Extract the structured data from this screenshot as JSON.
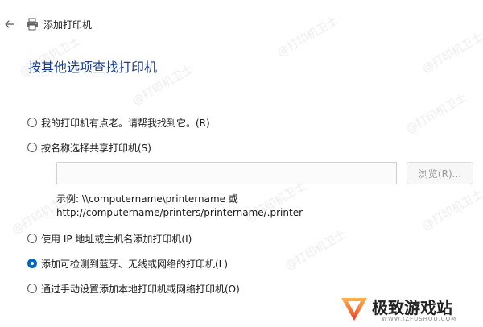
{
  "window": {
    "title": "添加打印机"
  },
  "heading": "按其他选项查找打印机",
  "options": [
    {
      "label": "我的打印机有点老。请帮我找到它。(R)",
      "checked": false
    },
    {
      "label": "按名称选择共享打印机(S)",
      "checked": false
    },
    {
      "label": "使用 IP 地址或主机名添加打印机(I)",
      "checked": false
    },
    {
      "label": "添加可检测到蓝牙、无线或网络的打印机(L)",
      "checked": true
    },
    {
      "label": "通过手动设置添加本地打印机或网络打印机(O)",
      "checked": false
    }
  ],
  "share": {
    "value": "",
    "browse_label": "浏览(R)...",
    "example_line1": "示例: \\\\computername\\printername 或",
    "example_line2": "http://computername/printers/printername/.printer"
  },
  "watermark": {
    "text": "@打印机卫士"
  },
  "logo": {
    "name": "极致游戏站",
    "sub": "WWW.JZFUSHOU.COM"
  },
  "colors": {
    "heading": "#1c3f8c",
    "accent": "#0067c0"
  },
  "icons": {
    "back": "arrow-left-icon",
    "printer": "printer-icon",
    "logo": "site-logo-icon"
  }
}
